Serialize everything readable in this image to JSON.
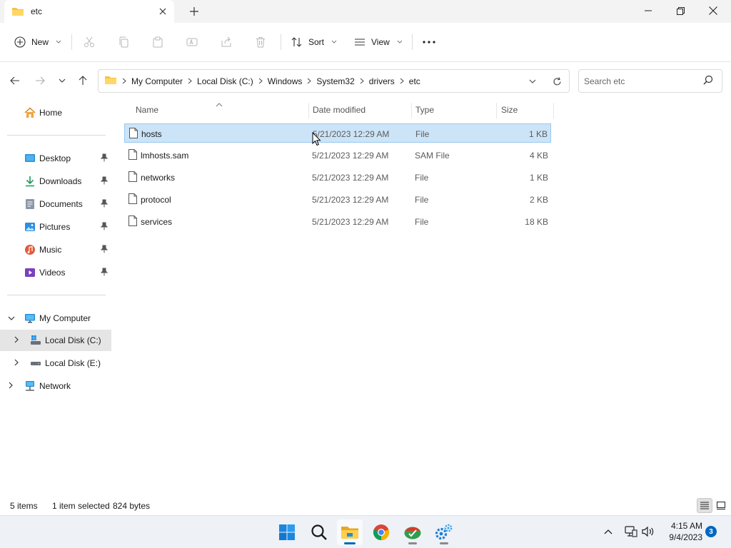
{
  "window": {
    "tab_title": "etc",
    "controls": [
      "minimize",
      "maximize",
      "close"
    ]
  },
  "colors": {
    "selection": "#cce4f7",
    "selection_border": "#99c9ef",
    "accent": "#0067c0",
    "folder": "#f6c342"
  },
  "toolbar": {
    "new_label": "New",
    "sort_label": "Sort",
    "view_label": "View",
    "disabled_actions": [
      "cut-icon",
      "copy-icon",
      "paste-icon",
      "rename-icon",
      "share-icon",
      "delete-icon"
    ],
    "more_icon": "more-icon"
  },
  "address": {
    "breadcrumbs": [
      "My Computer",
      "Local Disk (C:)",
      "Windows",
      "System32",
      "drivers",
      "etc"
    ]
  },
  "search": {
    "placeholder": "Search etc"
  },
  "sidebar": {
    "home": "Home",
    "quick_access": [
      {
        "label": "Desktop",
        "icon": "desktop-icon"
      },
      {
        "label": "Downloads",
        "icon": "downloads-icon"
      },
      {
        "label": "Documents",
        "icon": "documents-icon"
      },
      {
        "label": "Pictures",
        "icon": "pictures-icon"
      },
      {
        "label": "Music",
        "icon": "music-icon"
      },
      {
        "label": "Videos",
        "icon": "videos-icon"
      }
    ],
    "my_computer": "My Computer",
    "drives": [
      "Local Disk (C:)",
      "Local Disk (E:)"
    ],
    "network": "Network"
  },
  "file_list": {
    "columns": {
      "name": "Name",
      "date": "Date modified",
      "type": "Type",
      "size": "Size"
    },
    "rows": [
      {
        "name": "hosts",
        "date": "5/21/2023 12:29 AM",
        "type": "File",
        "size": "1 KB",
        "selected": true
      },
      {
        "name": "lmhosts.sam",
        "date": "5/21/2023 12:29 AM",
        "type": "SAM File",
        "size": "4 KB"
      },
      {
        "name": "networks",
        "date": "5/21/2023 12:29 AM",
        "type": "File",
        "size": "1 KB"
      },
      {
        "name": "protocol",
        "date": "5/21/2023 12:29 AM",
        "type": "File",
        "size": "2 KB"
      },
      {
        "name": "services",
        "date": "5/21/2023 12:29 AM",
        "type": "File",
        "size": "18 KB"
      }
    ]
  },
  "status": {
    "item_count": "5 items",
    "selected": "1 item selected",
    "size": "824 bytes"
  },
  "taskbar": {
    "apps": [
      "windows-start-icon",
      "search-icon",
      "file-explorer-icon",
      "chrome-icon",
      "app-icon",
      "settings-gear-icon"
    ],
    "time": "4:15 AM",
    "date": "9/4/2023",
    "notifications": "3"
  }
}
